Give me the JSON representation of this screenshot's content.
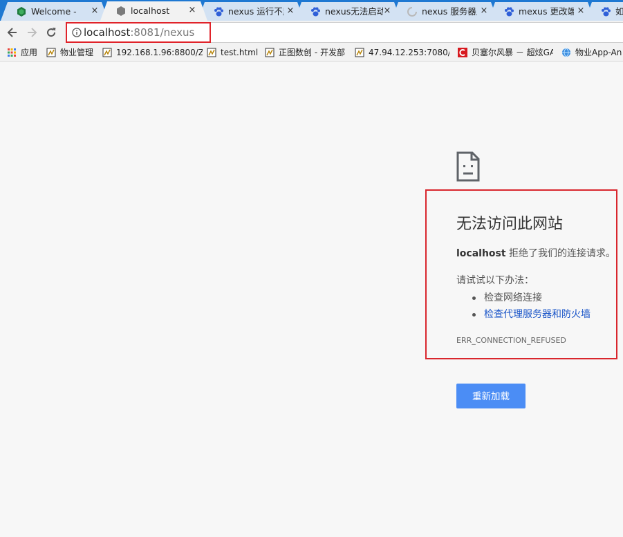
{
  "tabs": [
    {
      "title": "Welcome - Ne",
      "icon": "nexus-hexagon-icon"
    },
    {
      "title": "localhost",
      "icon": "gray-hexagon-icon",
      "active": true
    },
    {
      "title": "nexus 运行不起",
      "icon": "baidu-paw-icon"
    },
    {
      "title": "nexus无法启动",
      "icon": "baidu-paw-icon"
    },
    {
      "title": "nexus 服务器启",
      "icon": "loading-spinner-icon"
    },
    {
      "title": "mexus 更改端",
      "icon": "baidu-paw-icon"
    },
    {
      "title": "如何",
      "icon": "baidu-paw-icon"
    }
  ],
  "tab_close_glyph": "×",
  "address_bar": {
    "host": "localhost",
    "rest": ":8081/nexus"
  },
  "bookmarks": [
    {
      "label": "应用",
      "icon": "apps-grid-icon"
    },
    {
      "label": "物业管理",
      "icon": "page-icon"
    },
    {
      "label": "192.168.1.96:8800/Z",
      "icon": "page-icon"
    },
    {
      "label": "test.html",
      "icon": "page-icon"
    },
    {
      "label": "正图数创 - 开发部",
      "icon": "page-icon"
    },
    {
      "label": "47.94.12.253:7080/Z",
      "icon": "page-icon"
    },
    {
      "label": "贝塞尔风暴 － 超炫GA",
      "icon": "c-logo-icon"
    },
    {
      "label": "物业App-An",
      "icon": "globe-icon"
    }
  ],
  "error": {
    "title": "无法访问此网站",
    "host": "localhost",
    "desc_rest": " 拒绝了我们的连接请求。",
    "suggest_heading": "请试试以下办法：",
    "suggestions": [
      {
        "text": "检查网络连接",
        "link": false
      },
      {
        "text": "检查代理服务器和防火墙",
        "link": true
      }
    ],
    "code": "ERR_CONNECTION_REFUSED",
    "reload_label": "重新加载"
  },
  "colors": {
    "tabstrip": "#1e78d2",
    "highlight_border": "#d9262d",
    "reload_button": "#4b8df5",
    "link": "#1a55c8"
  }
}
